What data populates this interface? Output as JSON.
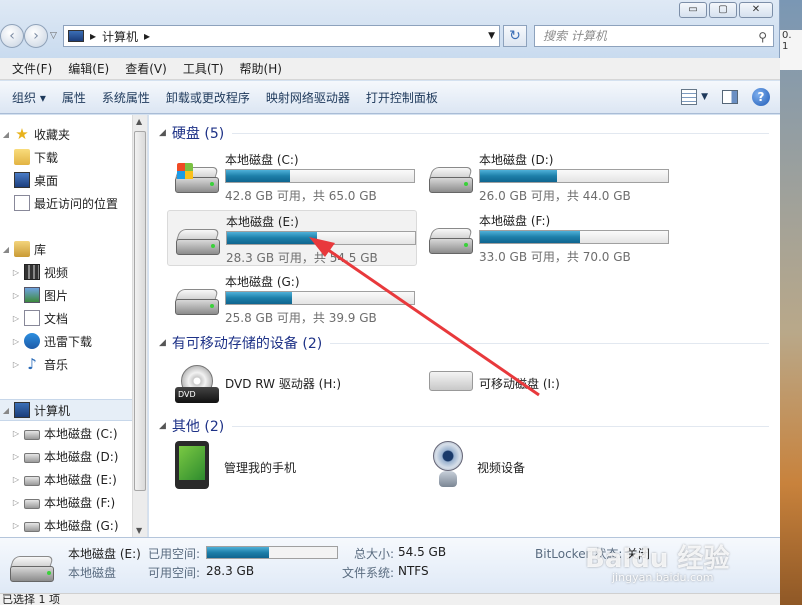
{
  "window": {
    "controls": [
      "▭",
      "▢",
      "✕"
    ],
    "path": [
      "计算机"
    ],
    "search_placeholder": "搜索 计算机"
  },
  "menu": [
    "文件(F)",
    "编辑(E)",
    "查看(V)",
    "工具(T)",
    "帮助(H)"
  ],
  "toolbar": {
    "organize": "组织 ▾",
    "items": [
      "属性",
      "系统属性",
      "卸载或更改程序",
      "映射网络驱动器",
      "打开控制面板"
    ]
  },
  "nav": {
    "favorites": "收藏夹",
    "fav_items": [
      "下载",
      "桌面",
      "最近访问的位置"
    ],
    "libraries": "库",
    "lib_items": [
      "视频",
      "图片",
      "文档",
      "迅雷下载",
      "音乐"
    ],
    "computer": "计算机",
    "drives": [
      "本地磁盘 (C:)",
      "本地磁盘 (D:)",
      "本地磁盘 (E:)",
      "本地磁盘 (F:)",
      "本地磁盘 (G:)"
    ]
  },
  "groups": {
    "hdd": "硬盘 (5)",
    "removable": "有可移动存储的设备 (2)",
    "other": "其他 (2)"
  },
  "drives": [
    {
      "name": "本地磁盘 (C:)",
      "info": "42.8 GB 可用，共 65.0 GB",
      "used_fraction": 0.34
    },
    {
      "name": "本地磁盘 (D:)",
      "info": "26.0 GB 可用，共 44.0 GB",
      "used_fraction": 0.41
    },
    {
      "name": "本地磁盘 (E:)",
      "info": "28.3 GB 可用，共 54.5 GB",
      "used_fraction": 0.48
    },
    {
      "name": "本地磁盘 (F:)",
      "info": "33.0 GB 可用，共 70.0 GB",
      "used_fraction": 0.53
    },
    {
      "name": "本地磁盘 (G:)",
      "info": "25.8 GB 可用，共 39.9 GB",
      "used_fraction": 0.35
    }
  ],
  "removable": {
    "dvd": "DVD RW 驱动器 (H:)",
    "dvd_icon_text": "DVD",
    "usb": "可移动磁盘 (I:)"
  },
  "other": {
    "phone": "管理我的手机",
    "video": "视频设备"
  },
  "details": {
    "name": "本地磁盘 (E:)",
    "type": "本地磁盘",
    "used_label": "已用空间:",
    "free_label": "可用空间:",
    "free_value": "28.3 GB",
    "used_fraction": 0.48,
    "total_label": "总大小:",
    "total_value": "54.5 GB",
    "fs_label": "文件系统:",
    "fs_value": "NTFS",
    "bitlocker": "BitLocker 状态:",
    "bitlocker_value": "关闭"
  },
  "status": "已选择 1 项",
  "right_strip": [
    "0.",
    "1"
  ],
  "watermark": {
    "main": "Baidu 经验",
    "sub": "jingyan.baidu.com"
  }
}
